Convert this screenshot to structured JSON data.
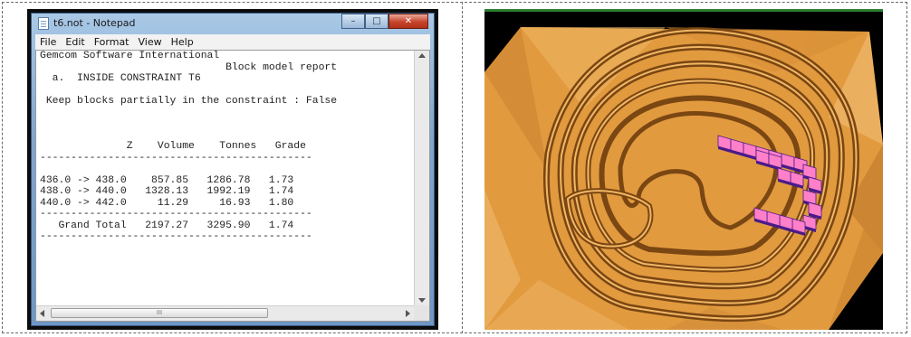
{
  "notepad": {
    "title": "t6.not - Notepad",
    "caption": {
      "minimize": "–",
      "maximize": "□",
      "close": "✕"
    },
    "menu": [
      "File",
      "Edit",
      "Format",
      "View",
      "Help"
    ],
    "report": {
      "company": "Gemcom Software International",
      "report_title": "Block model report",
      "section": "a.  INSIDE CONSTRAINT T6",
      "option": "Keep blocks partially in the constraint : False",
      "columns": [
        "Z",
        "Volume",
        "Tonnes",
        "Grade"
      ],
      "separator": "--------------------------------------------",
      "rows": [
        {
          "z": "436.0 -> 438.0",
          "volume": "857.85",
          "tonnes": "1286.78",
          "grade": "1.73"
        },
        {
          "z": "438.0 -> 440.0",
          "volume": "1328.13",
          "tonnes": "1992.19",
          "grade": "1.74"
        },
        {
          "z": "440.0 -> 442.0",
          "volume": "11.29",
          "tonnes": "16.93",
          "grade": "1.80"
        }
      ],
      "total": {
        "label": "Grand Total",
        "volume": "2197.27",
        "tonnes": "3295.90",
        "grade": "1.74"
      }
    },
    "hscroll_thumb_label": "III"
  },
  "viewer": {
    "background": "#000000",
    "pit_color": "#e29a3f",
    "bench_shadow_color": "#7a4612",
    "block_color": "#ff7fc8",
    "block_edge_color": "#4a1a8a",
    "top_bar_color": "#2e7d32"
  }
}
